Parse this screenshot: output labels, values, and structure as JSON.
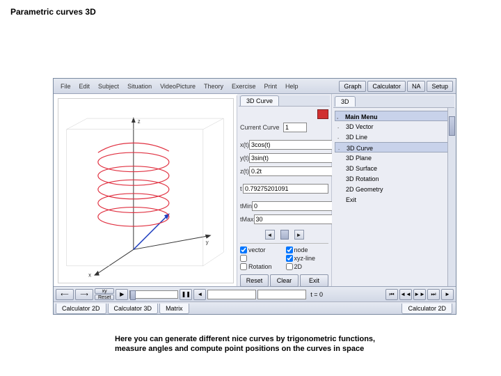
{
  "page_title": "Parametric curves 3D",
  "menubar": {
    "items": [
      "File",
      "Edit",
      "Subject",
      "Situation",
      "VideoPicture",
      "Theory",
      "Exercise",
      "Print",
      "Help"
    ],
    "buttons": [
      "Graph",
      "Calculator",
      "NA",
      "Setup"
    ]
  },
  "mid_tab": "3D Curve",
  "right_tab": "3D",
  "current_curve_label": "Current Curve",
  "current_curve_value": "1",
  "fields": {
    "xt": {
      "label": "x(t)",
      "value": "3cos(t)"
    },
    "yt": {
      "label": "y(t)",
      "value": "3sin(t)"
    },
    "zt": {
      "label": "z(t)",
      "value": "0.2t"
    },
    "t": {
      "label": "t",
      "value": "0.79275201091"
    },
    "tmin": {
      "label": "tMin",
      "value": "0"
    },
    "tmax": {
      "label": "tMax",
      "value": "30"
    }
  },
  "checks": {
    "vector": "vector",
    "node": "node",
    "blank": "",
    "xyzline": "xyz-line",
    "rotation": "Rotation",
    "twod": "2D"
  },
  "buttons": {
    "reset": "Reset",
    "clear": "Clear",
    "exit": "Exit"
  },
  "menu": {
    "head": "Main Menu",
    "items": [
      {
        "label": "3D Vector",
        "bullet": true
      },
      {
        "label": "3D Line",
        "bullet": true
      },
      {
        "label": "3D Curve",
        "bullet": true,
        "sel": true
      },
      {
        "label": "3D Plane"
      },
      {
        "label": "3D Surface"
      },
      {
        "label": "3D Rotation"
      },
      {
        "label": "2D Geometry"
      },
      {
        "label": "Exit"
      }
    ]
  },
  "toolbar": {
    "xy": "xy",
    "reset": "Reset",
    "teq": "t = 0"
  },
  "bottom_tabs": {
    "calc2d": "Calculator 2D",
    "calc3d": "Calculator 3D",
    "matrix": "Matrix",
    "right": "Calculator 2D"
  },
  "axes": {
    "x": "x",
    "y": "y",
    "z": "z"
  },
  "caption": "Here you can generate different nice curves by trigonometric functions, measure angles and compute point positions on the curves in space"
}
